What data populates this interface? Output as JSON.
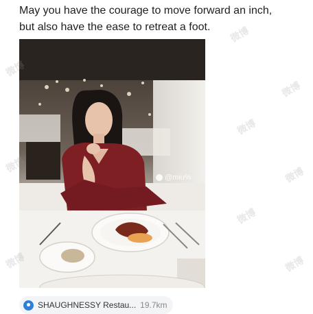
{
  "post": {
    "line1": "May you have the courage to move forward an inch,",
    "line2": "but also have the ease to retreat a foot."
  },
  "photo": {
    "watermark_handle": "@miu%",
    "description_icon": "weibo-icon"
  },
  "watermark_text": "微博",
  "location": {
    "name": "SHAUGHNESSY Restau...",
    "distance": "19.7km",
    "icon": "location-pin-icon",
    "accent": "#2f7fd8"
  }
}
